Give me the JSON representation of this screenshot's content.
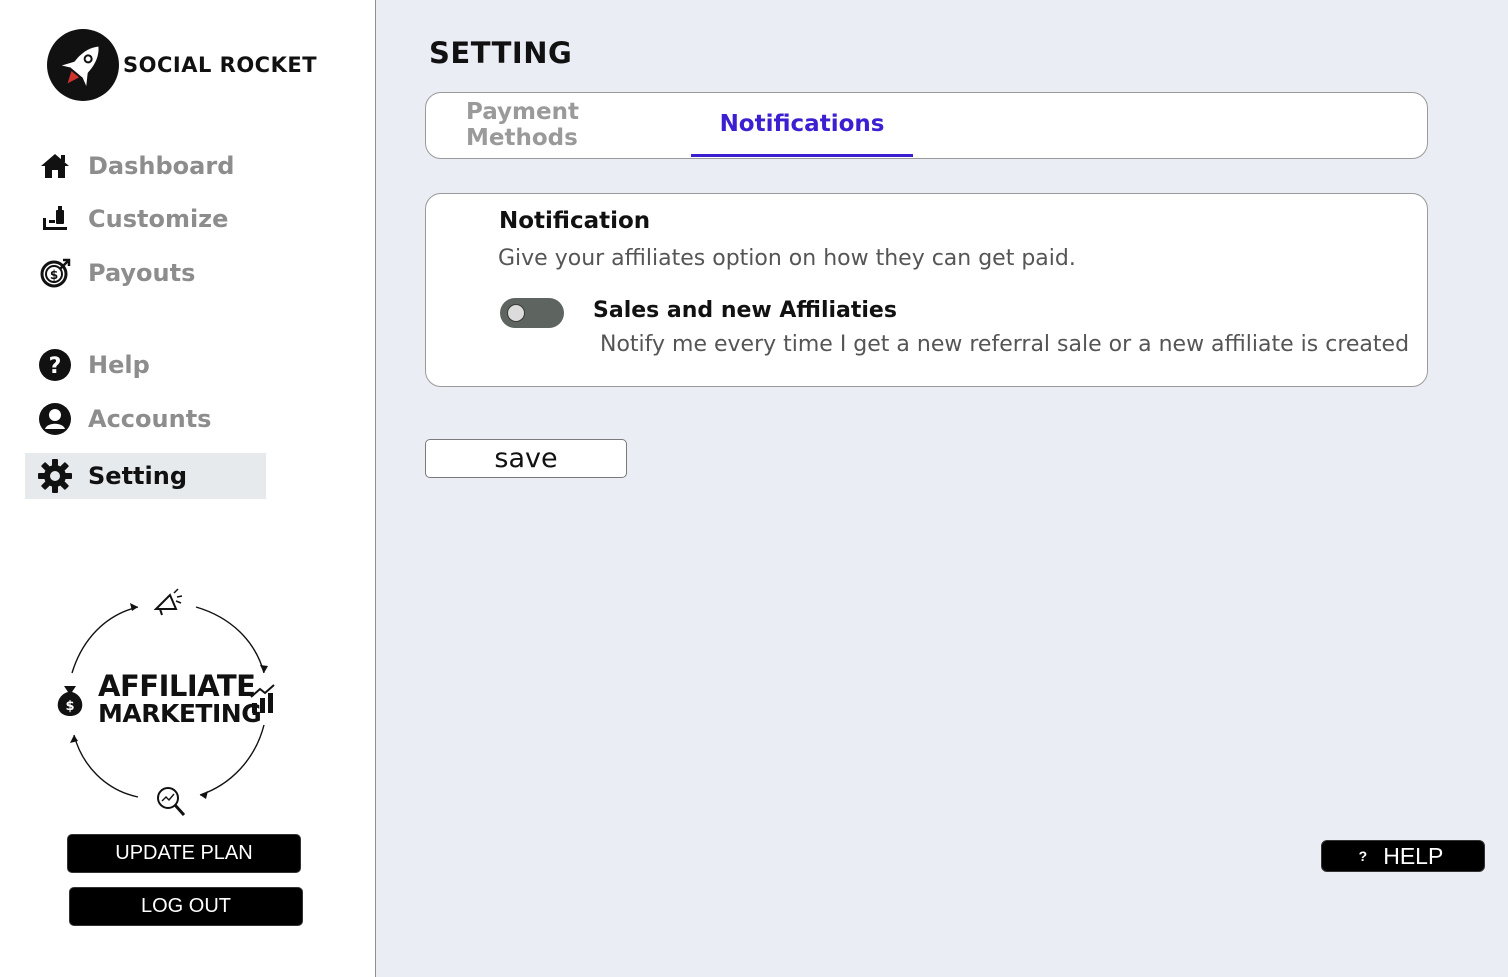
{
  "brand": {
    "name": "SOCIAL ROCKET"
  },
  "sidebar": {
    "items": [
      {
        "label": "Dashboard",
        "icon": "home-icon"
      },
      {
        "label": "Customize",
        "icon": "customize-icon"
      },
      {
        "label": "Payouts",
        "icon": "payouts-icon"
      },
      {
        "label": "Help",
        "icon": "help-circle-icon"
      },
      {
        "label": "Accounts",
        "icon": "user-circle-icon"
      },
      {
        "label": "Setting",
        "icon": "gear-icon",
        "active": true
      }
    ],
    "illustration": {
      "line1": "AFFILIATE",
      "line2": "MARKETING"
    },
    "update_plan_label": "UPDATE PLAN",
    "logout_label": "LOG OUT"
  },
  "main": {
    "title": "SETTING",
    "tabs": [
      {
        "label": "Payment Methods",
        "active": false
      },
      {
        "label": "Notifications",
        "active": true
      }
    ],
    "notification": {
      "title": "Notification",
      "subtitle": "Give your affiliates option on how they can get paid.",
      "option": {
        "title": "Sales and new Affiliaties",
        "description": "Notify me every time I get a new referral sale or a new affiliate is created",
        "enabled": false
      }
    },
    "save_label": "save",
    "help_button": {
      "icon": "?",
      "label": "HELP"
    }
  },
  "colors": {
    "accent": "#3b1fd0",
    "background": "#ebedf5",
    "active_nav": "#e6eaec"
  }
}
